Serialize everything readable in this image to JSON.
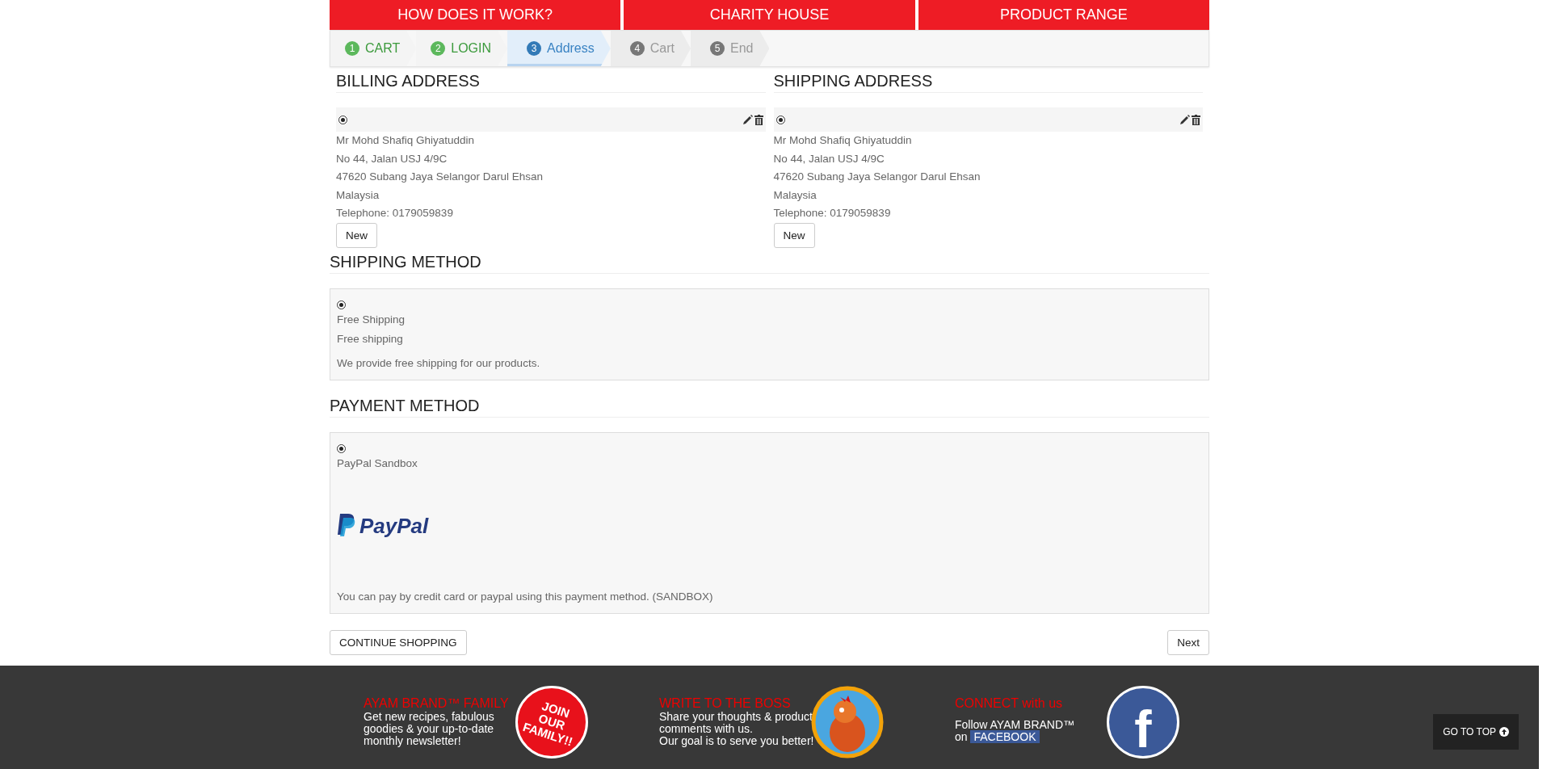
{
  "top_nav": [
    {
      "label": "HOW DOES IT WORK?"
    },
    {
      "label": "CHARITY HOUSE"
    },
    {
      "label": "PRODUCT RANGE"
    }
  ],
  "steps": [
    {
      "number": "1",
      "label": "CART",
      "completed": true,
      "selected": false
    },
    {
      "number": "2",
      "label": "LOGIN",
      "completed": true,
      "selected": false
    },
    {
      "number": "3",
      "label": "Address",
      "completed": false,
      "selected": true
    },
    {
      "number": "4",
      "label": "Cart",
      "completed": false,
      "selected": false
    },
    {
      "number": "5",
      "label": "End",
      "completed": false,
      "selected": false
    }
  ],
  "addresses": [
    {
      "title": "BILLING ADDRESS",
      "selected": true,
      "lines": [
        "Mr Mohd Shafiq Ghiyatuddin",
        "No 44, Jalan USJ 4/9C",
        "47620 Subang Jaya Selangor Darul Ehsan",
        "Malaysia",
        "Telephone: 0179059839"
      ],
      "button": "New"
    },
    {
      "title": "SHIPPING ADDRESS",
      "selected": true,
      "lines": [
        "Mr Mohd Shafiq Ghiyatuddin",
        "No 44, Jalan USJ 4/9C",
        "47620 Subang Jaya Selangor Darul Ehsan",
        "Malaysia",
        "Telephone: 0179059839"
      ],
      "button": "New"
    }
  ],
  "shipping_method": {
    "title": "SHIPPING METHOD",
    "selected": true,
    "name": "Free Shipping",
    "option": "Free shipping",
    "description": "We provide free shipping for our products."
  },
  "payment_method": {
    "title": "PAYMENT METHOD",
    "selected": true,
    "name": "PayPal Sandbox",
    "logo_text": "PayPal",
    "description": "You can pay by credit card or paypal using this payment method. (SANDBOX)"
  },
  "actions": {
    "continue": "CONTINUE SHOPPING",
    "next": "Next"
  },
  "footer": [
    {
      "kind": "family",
      "title": "AYAM BRAND™ FAMILY",
      "lines": [
        "Get new recipes, fabulous",
        "goodies & your up-to-date",
        "monthly newsletter!"
      ],
      "sticker_text": "JOIN OUR FAMILY!!"
    },
    {
      "kind": "boss",
      "title": "WRITE TO THE BOSS",
      "lines": [
        "Share your thoughts & product",
        "comments with us.",
        "Our goal is to serve you better!"
      ]
    },
    {
      "kind": "facebook",
      "title": "CONNECT with us",
      "lines": [
        "Follow AYAM BRAND™"
      ],
      "prefix": "on",
      "link": "FACEBOOK",
      "sticker_text": "f"
    }
  ],
  "go_to_top": "GO TO TOP"
}
